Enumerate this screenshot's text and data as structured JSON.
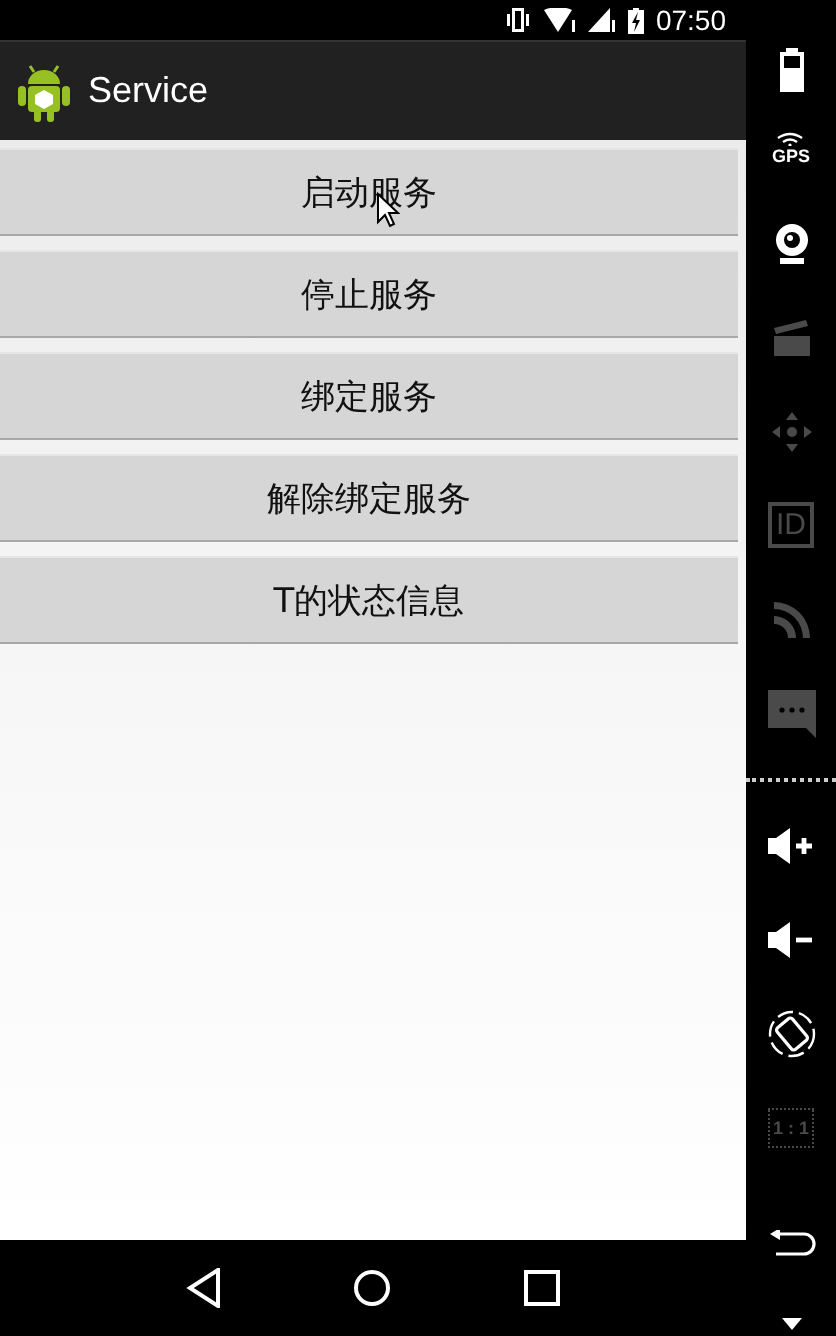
{
  "status_bar": {
    "time": "07:50"
  },
  "app_bar": {
    "title": "Service"
  },
  "buttons": [
    {
      "label": "启动服务"
    },
    {
      "label": "停止服务"
    },
    {
      "label": "绑定服务"
    },
    {
      "label": "解除绑定服务"
    },
    {
      "label": "T的状态信息"
    }
  ],
  "side_toolbar": [
    {
      "kind": "battery",
      "disabled": false
    },
    {
      "kind": "gps",
      "label": "GPS",
      "disabled": false
    },
    {
      "kind": "camera",
      "disabled": false
    },
    {
      "kind": "video",
      "disabled": true
    },
    {
      "kind": "dpad",
      "disabled": true
    },
    {
      "kind": "id",
      "label": "ID",
      "disabled": true
    },
    {
      "kind": "rss",
      "disabled": true
    },
    {
      "kind": "chat",
      "disabled": true
    },
    {
      "kind": "divider"
    },
    {
      "kind": "volume_up",
      "disabled": false
    },
    {
      "kind": "volume_down",
      "disabled": false
    },
    {
      "kind": "rotate",
      "disabled": false
    },
    {
      "kind": "scale",
      "label": "1 : 1",
      "disabled": true
    },
    {
      "kind": "back",
      "disabled": false
    },
    {
      "kind": "more",
      "disabled": false
    }
  ]
}
